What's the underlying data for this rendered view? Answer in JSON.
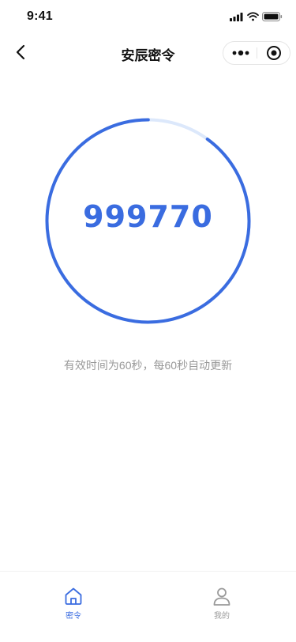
{
  "status_bar": {
    "time": "9:41",
    "icons": [
      "signal-icon",
      "wifi-icon",
      "battery-icon"
    ]
  },
  "nav": {
    "back_icon": "chevron-left-icon",
    "title": "安辰密令",
    "capsule": {
      "more_icon": "more-dots-icon",
      "close_icon": "target-close-icon"
    }
  },
  "token": {
    "code": "999770",
    "hint": "有效时间为60秒，每60秒自动更新",
    "remaining_fraction": 0.9
  },
  "tab_bar": {
    "items": [
      {
        "label": "密令",
        "icon": "home-icon",
        "active": true
      },
      {
        "label": "我的",
        "icon": "user-icon",
        "active": false
      }
    ]
  },
  "colors": {
    "accent": "#3a6ce0",
    "ring_track": "#dce8fb",
    "hint_text": "#999999",
    "inactive_tab": "#9a9a9a"
  }
}
